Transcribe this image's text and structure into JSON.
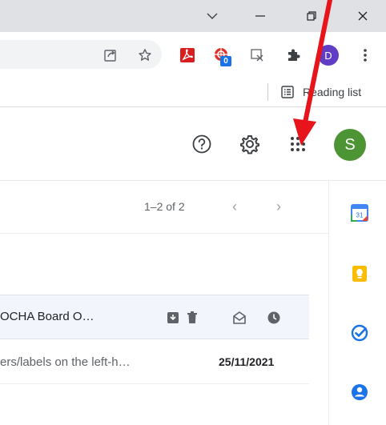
{
  "window_controls": {
    "dropdown_icon": "chevron-down-icon",
    "minimize_icon": "minimize-icon",
    "restore_icon": "restore-icon",
    "close_icon": "close-icon"
  },
  "toolbar": {
    "extension_badge": "0",
    "profile_initial": "D"
  },
  "bookmarks": {
    "reading_list_label": "Reading list"
  },
  "gmail": {
    "avatar_initial": "S",
    "avatar_color": "#4d9434",
    "pagination": "1–2 of 2"
  },
  "emails": [
    {
      "subject": "OCHA Board O…"
    },
    {
      "snippet": "ers/labels on the left-h…",
      "date": "25/11/2021"
    }
  ],
  "side_panel": {
    "calendar_day": "31"
  },
  "colors": {
    "accent_red": "#e8141b",
    "selected_row": "#f2f6fc",
    "profile_purple": "#5f3dc4"
  }
}
